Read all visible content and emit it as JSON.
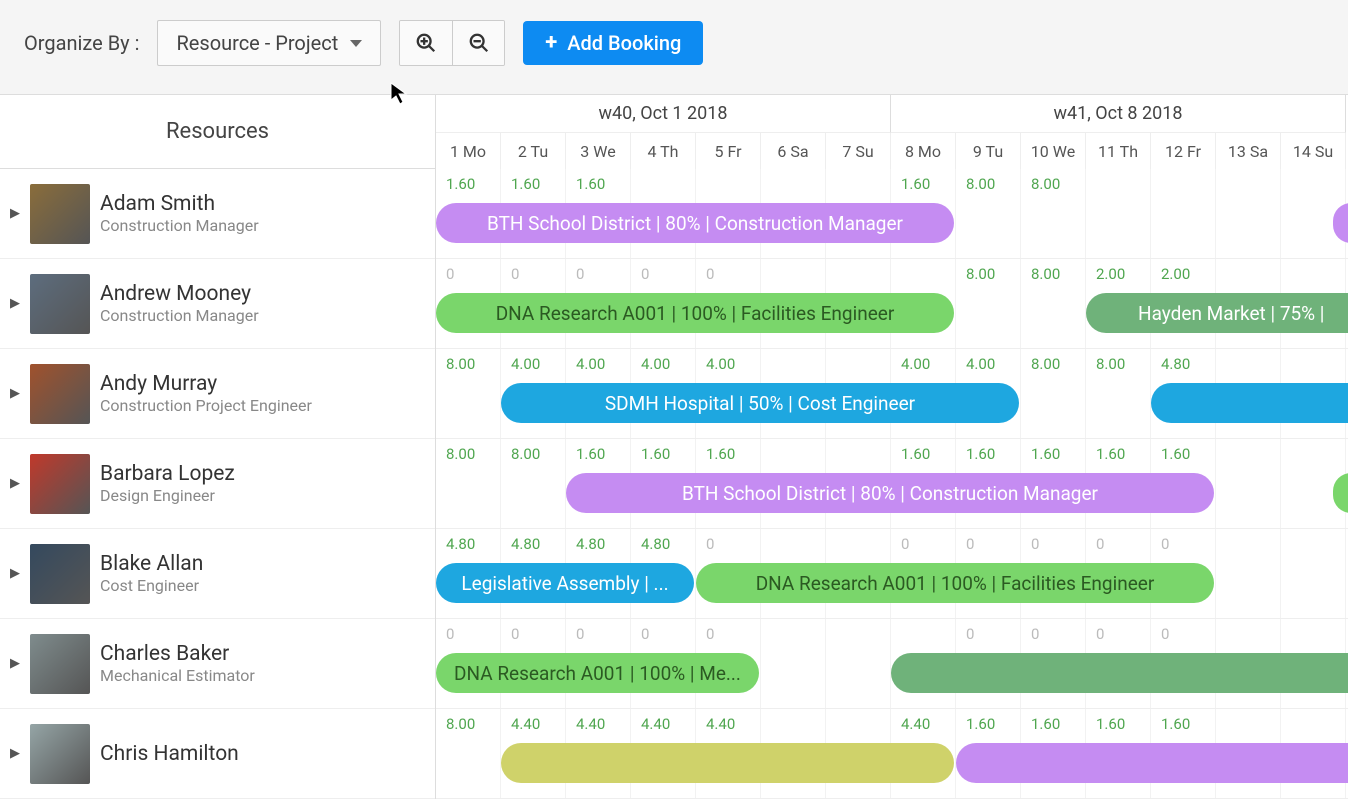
{
  "toolbar": {
    "organize_label": "Organize By :",
    "organize_value": "Resource - Project",
    "add_label": "Add Booking"
  },
  "header": {
    "resources_label": "Resources",
    "weeks": [
      "w40, Oct 1 2018",
      "w41, Oct 8 2018"
    ],
    "days": [
      "1 Mo",
      "2 Tu",
      "3 We",
      "4 Th",
      "5 Fr",
      "6 Sa",
      "7 Su",
      "8 Mo",
      "9 Tu",
      "10 We",
      "11 Th",
      "12 Fr",
      "13 Sa",
      "14 Su"
    ]
  },
  "resources": [
    {
      "name": "Adam Smith",
      "role": "Construction Manager",
      "hours": [
        "1.60",
        "1.60",
        "1.60",
        "",
        "",
        "",
        "",
        "1.60",
        "8.00",
        "8.00",
        "",
        "",
        "",
        ""
      ],
      "bars": [
        {
          "label": "BTH School District | 80% | Construction Manager",
          "start": 0,
          "span": 8,
          "color": "purple"
        },
        {
          "label": "",
          "start": 13.8,
          "span": 0.5,
          "color": "purple"
        }
      ]
    },
    {
      "name": "Andrew Mooney",
      "role": "Construction Manager",
      "hours": [
        "0",
        "0",
        "0",
        "0",
        "0",
        "",
        "",
        "",
        "8.00",
        "8.00",
        "2.00",
        "2.00",
        "",
        ""
      ],
      "bars": [
        {
          "label": "DNA Research A001 | 100% | Facilities Engineer",
          "start": 0,
          "span": 8,
          "color": "green"
        },
        {
          "label": "Hayden Market | 75% | ",
          "start": 10,
          "span": 4.5,
          "color": "dgreen"
        }
      ]
    },
    {
      "name": "Andy Murray",
      "role": "Construction Project Engineer",
      "hours": [
        "8.00",
        "4.00",
        "4.00",
        "4.00",
        "4.00",
        "",
        "",
        "4.00",
        "4.00",
        "8.00",
        "8.00",
        "4.80",
        "",
        ""
      ],
      "bars": [
        {
          "label": "SDMH Hospital | 50% | Cost Engineer",
          "start": 1,
          "span": 8,
          "color": "blue"
        },
        {
          "label": "",
          "start": 11,
          "span": 3.5,
          "color": "blue"
        }
      ]
    },
    {
      "name": "Barbara Lopez",
      "role": "Design Engineer",
      "hours": [
        "8.00",
        "8.00",
        "1.60",
        "1.60",
        "1.60",
        "",
        "",
        "1.60",
        "1.60",
        "1.60",
        "1.60",
        "1.60",
        "",
        ""
      ],
      "bars": [
        {
          "label": "BTH School District | 80% | Construction Manager",
          "start": 2,
          "span": 10,
          "color": "purple"
        },
        {
          "label": "",
          "start": 13.8,
          "span": 0.5,
          "color": "green"
        }
      ]
    },
    {
      "name": "Blake Allan",
      "role": "Cost Engineer",
      "hours": [
        "4.80",
        "4.80",
        "4.80",
        "4.80",
        "0",
        "",
        "",
        "0",
        "0",
        "0",
        "0",
        "0",
        "",
        ""
      ],
      "bars": [
        {
          "label": "Legislative Assembly | ...",
          "start": 0,
          "span": 4,
          "color": "blue"
        },
        {
          "label": "DNA Research A001 | 100% | Facilities Engineer",
          "start": 4,
          "span": 8,
          "color": "green"
        }
      ]
    },
    {
      "name": "Charles Baker",
      "role": "Mechanical Estimator",
      "hours": [
        "0",
        "0",
        "0",
        "0",
        "0",
        "",
        "",
        "",
        "0",
        "0",
        "0",
        "0",
        "",
        ""
      ],
      "bars": [
        {
          "label": "DNA Research A001 | 100% | Me...",
          "start": 0,
          "span": 5,
          "color": "green"
        },
        {
          "label": "",
          "start": 7,
          "span": 7.5,
          "color": "dgreen"
        }
      ]
    },
    {
      "name": "Chris Hamilton",
      "role": "",
      "hours": [
        "8.00",
        "4.40",
        "4.40",
        "4.40",
        "4.40",
        "",
        "",
        "4.40",
        "1.60",
        "1.60",
        "1.60",
        "1.60",
        "",
        ""
      ],
      "bars": [
        {
          "label": "",
          "start": 1,
          "span": 7,
          "color": "olive"
        },
        {
          "label": "",
          "start": 8,
          "span": 6.5,
          "color": "purple"
        }
      ]
    }
  ]
}
